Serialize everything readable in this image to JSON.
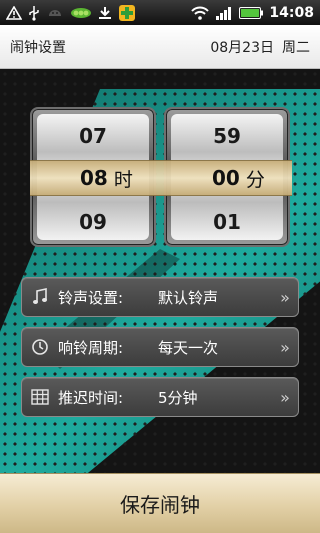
{
  "status_bar": {
    "time": "14:08",
    "icons": [
      "warning-icon",
      "usb-icon",
      "android-icon",
      "pea-icon",
      "download-icon",
      "app-icon",
      "wifi-icon",
      "signal-icon",
      "battery-icon"
    ]
  },
  "title_bar": {
    "title": "闹钟设置",
    "date": "08月23日",
    "weekday": "周二"
  },
  "picker": {
    "hour_prev": "07",
    "hour_selected": "08",
    "hour_next": "09",
    "hour_unit": "时",
    "minute_prev": "59",
    "minute_selected": "00",
    "minute_next": "01",
    "minute_unit": "分"
  },
  "settings": [
    {
      "label": "铃声设置:",
      "value": "默认铃声",
      "icon": "music-note-icon"
    },
    {
      "label": "响铃周期:",
      "value": "每天一次",
      "icon": "clock-icon"
    },
    {
      "label": "推迟时间:",
      "value": "5分钟",
      "icon": "calendar-grid-icon"
    }
  ],
  "save_label": "保存闹钟",
  "colors": {
    "teal": "#1aa397",
    "gold": "#e9d8b0",
    "background": "#141414"
  }
}
